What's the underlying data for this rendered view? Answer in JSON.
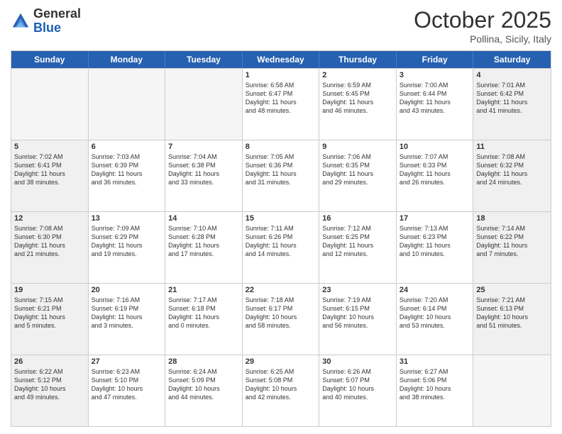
{
  "header": {
    "logo_general": "General",
    "logo_blue": "Blue",
    "month": "October 2025",
    "location": "Pollina, Sicily, Italy"
  },
  "days_of_week": [
    "Sunday",
    "Monday",
    "Tuesday",
    "Wednesday",
    "Thursday",
    "Friday",
    "Saturday"
  ],
  "rows": [
    [
      {
        "day": "",
        "info": "",
        "empty": true
      },
      {
        "day": "",
        "info": "",
        "empty": true
      },
      {
        "day": "",
        "info": "",
        "empty": true
      },
      {
        "day": "1",
        "info": "Sunrise: 6:58 AM\nSunset: 6:47 PM\nDaylight: 11 hours\nand 48 minutes.",
        "empty": false
      },
      {
        "day": "2",
        "info": "Sunrise: 6:59 AM\nSunset: 6:45 PM\nDaylight: 11 hours\nand 46 minutes.",
        "empty": false
      },
      {
        "day": "3",
        "info": "Sunrise: 7:00 AM\nSunset: 6:44 PM\nDaylight: 11 hours\nand 43 minutes.",
        "empty": false
      },
      {
        "day": "4",
        "info": "Sunrise: 7:01 AM\nSunset: 6:42 PM\nDaylight: 11 hours\nand 41 minutes.",
        "empty": false,
        "shaded": true
      }
    ],
    [
      {
        "day": "5",
        "info": "Sunrise: 7:02 AM\nSunset: 6:41 PM\nDaylight: 11 hours\nand 38 minutes.",
        "empty": false,
        "shaded": true
      },
      {
        "day": "6",
        "info": "Sunrise: 7:03 AM\nSunset: 6:39 PM\nDaylight: 11 hours\nand 36 minutes.",
        "empty": false
      },
      {
        "day": "7",
        "info": "Sunrise: 7:04 AM\nSunset: 6:38 PM\nDaylight: 11 hours\nand 33 minutes.",
        "empty": false
      },
      {
        "day": "8",
        "info": "Sunrise: 7:05 AM\nSunset: 6:36 PM\nDaylight: 11 hours\nand 31 minutes.",
        "empty": false
      },
      {
        "day": "9",
        "info": "Sunrise: 7:06 AM\nSunset: 6:35 PM\nDaylight: 11 hours\nand 29 minutes.",
        "empty": false
      },
      {
        "day": "10",
        "info": "Sunrise: 7:07 AM\nSunset: 6:33 PM\nDaylight: 11 hours\nand 26 minutes.",
        "empty": false
      },
      {
        "day": "11",
        "info": "Sunrise: 7:08 AM\nSunset: 6:32 PM\nDaylight: 11 hours\nand 24 minutes.",
        "empty": false,
        "shaded": true
      }
    ],
    [
      {
        "day": "12",
        "info": "Sunrise: 7:08 AM\nSunset: 6:30 PM\nDaylight: 11 hours\nand 21 minutes.",
        "empty": false,
        "shaded": true
      },
      {
        "day": "13",
        "info": "Sunrise: 7:09 AM\nSunset: 6:29 PM\nDaylight: 11 hours\nand 19 minutes.",
        "empty": false
      },
      {
        "day": "14",
        "info": "Sunrise: 7:10 AM\nSunset: 6:28 PM\nDaylight: 11 hours\nand 17 minutes.",
        "empty": false
      },
      {
        "day": "15",
        "info": "Sunrise: 7:11 AM\nSunset: 6:26 PM\nDaylight: 11 hours\nand 14 minutes.",
        "empty": false
      },
      {
        "day": "16",
        "info": "Sunrise: 7:12 AM\nSunset: 6:25 PM\nDaylight: 11 hours\nand 12 minutes.",
        "empty": false
      },
      {
        "day": "17",
        "info": "Sunrise: 7:13 AM\nSunset: 6:23 PM\nDaylight: 11 hours\nand 10 minutes.",
        "empty": false
      },
      {
        "day": "18",
        "info": "Sunrise: 7:14 AM\nSunset: 6:22 PM\nDaylight: 11 hours\nand 7 minutes.",
        "empty": false,
        "shaded": true
      }
    ],
    [
      {
        "day": "19",
        "info": "Sunrise: 7:15 AM\nSunset: 6:21 PM\nDaylight: 11 hours\nand 5 minutes.",
        "empty": false,
        "shaded": true
      },
      {
        "day": "20",
        "info": "Sunrise: 7:16 AM\nSunset: 6:19 PM\nDaylight: 11 hours\nand 3 minutes.",
        "empty": false
      },
      {
        "day": "21",
        "info": "Sunrise: 7:17 AM\nSunset: 6:18 PM\nDaylight: 11 hours\nand 0 minutes.",
        "empty": false
      },
      {
        "day": "22",
        "info": "Sunrise: 7:18 AM\nSunset: 6:17 PM\nDaylight: 10 hours\nand 58 minutes.",
        "empty": false
      },
      {
        "day": "23",
        "info": "Sunrise: 7:19 AM\nSunset: 6:15 PM\nDaylight: 10 hours\nand 56 minutes.",
        "empty": false
      },
      {
        "day": "24",
        "info": "Sunrise: 7:20 AM\nSunset: 6:14 PM\nDaylight: 10 hours\nand 53 minutes.",
        "empty": false
      },
      {
        "day": "25",
        "info": "Sunrise: 7:21 AM\nSunset: 6:13 PM\nDaylight: 10 hours\nand 51 minutes.",
        "empty": false,
        "shaded": true
      }
    ],
    [
      {
        "day": "26",
        "info": "Sunrise: 6:22 AM\nSunset: 5:12 PM\nDaylight: 10 hours\nand 49 minutes.",
        "empty": false,
        "shaded": true
      },
      {
        "day": "27",
        "info": "Sunrise: 6:23 AM\nSunset: 5:10 PM\nDaylight: 10 hours\nand 47 minutes.",
        "empty": false
      },
      {
        "day": "28",
        "info": "Sunrise: 6:24 AM\nSunset: 5:09 PM\nDaylight: 10 hours\nand 44 minutes.",
        "empty": false
      },
      {
        "day": "29",
        "info": "Sunrise: 6:25 AM\nSunset: 5:08 PM\nDaylight: 10 hours\nand 42 minutes.",
        "empty": false
      },
      {
        "day": "30",
        "info": "Sunrise: 6:26 AM\nSunset: 5:07 PM\nDaylight: 10 hours\nand 40 minutes.",
        "empty": false
      },
      {
        "day": "31",
        "info": "Sunrise: 6:27 AM\nSunset: 5:06 PM\nDaylight: 10 hours\nand 38 minutes.",
        "empty": false
      },
      {
        "day": "",
        "info": "",
        "empty": true,
        "shaded": true
      }
    ]
  ]
}
